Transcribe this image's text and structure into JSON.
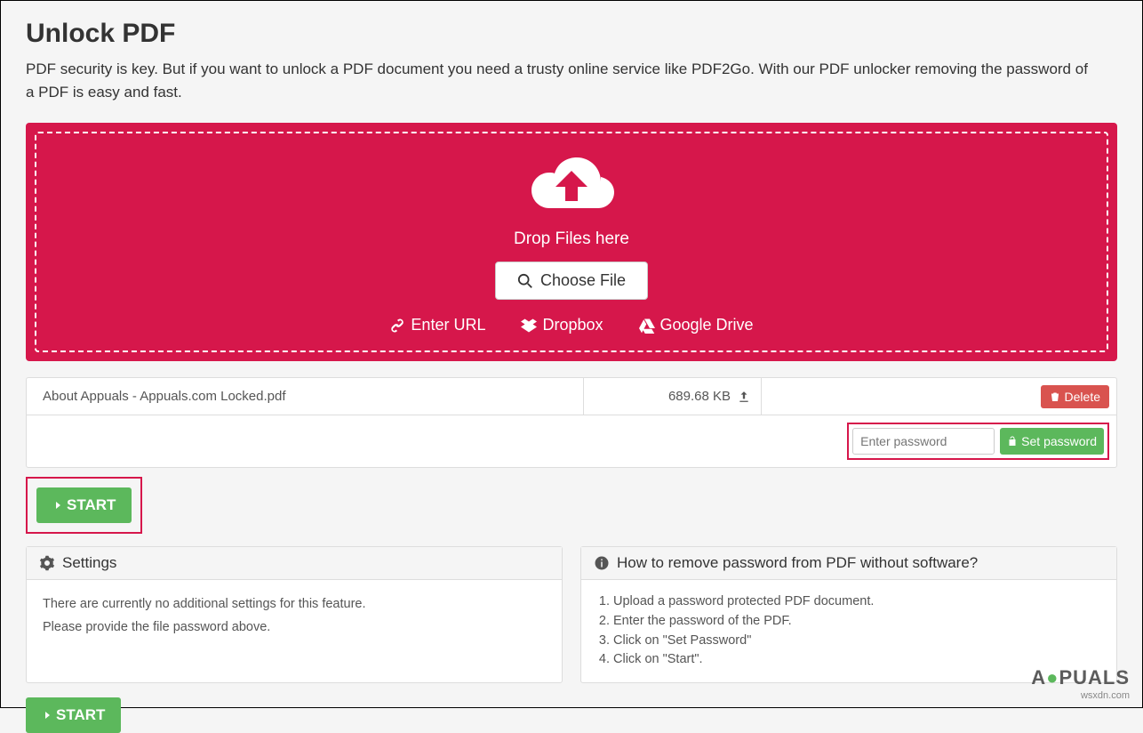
{
  "header": {
    "title": "Unlock PDF",
    "subtitle": "PDF security is key. But if you want to unlock a PDF document you need a trusty online service like PDF2Go. With our PDF unlocker removing the password of a PDF is easy and fast."
  },
  "dropzone": {
    "drop_text": "Drop Files here",
    "choose_label": "Choose File",
    "sources": {
      "url": "Enter URL",
      "dropbox": "Dropbox",
      "gdrive": "Google Drive"
    }
  },
  "file": {
    "name": "About Appuals - Appuals.com Locked.pdf",
    "size": "689.68 KB",
    "delete_label": "Delete"
  },
  "password": {
    "placeholder": "Enter password",
    "set_label": "Set password"
  },
  "start_label": "START",
  "settings_panel": {
    "title": "Settings",
    "line1": "There are currently no additional settings for this feature.",
    "line2": "Please provide the file password above."
  },
  "howto_panel": {
    "title": "How to remove password from PDF without software?",
    "steps": [
      "Upload a password protected PDF document.",
      "Enter the password of the PDF.",
      "Click on \"Set Password\"",
      "Click on \"Start\"."
    ]
  },
  "watermark": {
    "brand": "APPUALS",
    "site": "wsxdn.com"
  }
}
